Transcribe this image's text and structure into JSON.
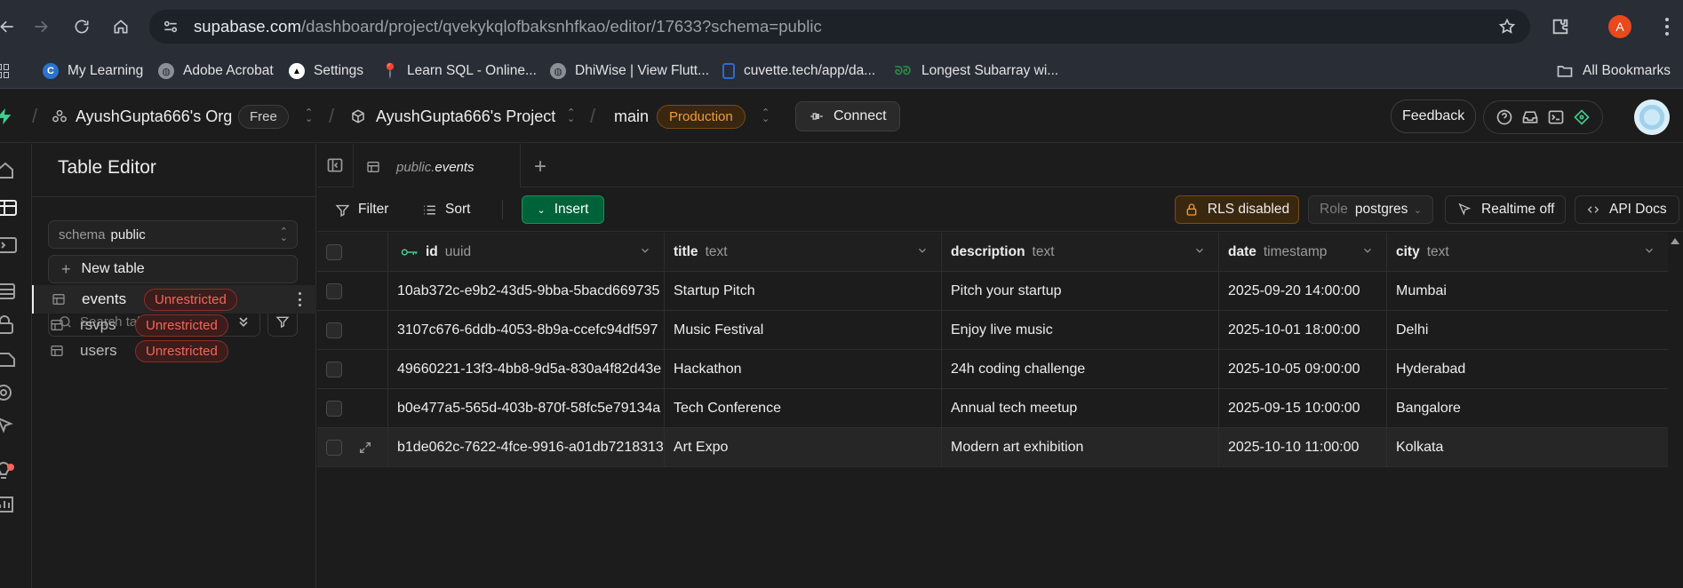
{
  "browser": {
    "url_host": "supabase.com",
    "url_path": "/dashboard/project/qvekykqlofbaksnhfkao/editor/17633?schema=public",
    "profile_initial": "A",
    "bookmarks": [
      {
        "label": "My Learning",
        "icon": "coursera-c-icon"
      },
      {
        "label": "Adobe Acrobat",
        "icon": "globe-icon"
      },
      {
        "label": "Settings",
        "icon": "triangle-logo-icon"
      },
      {
        "label": "Learn SQL - Online...",
        "icon": "pin-icon"
      },
      {
        "label": "DhiWise | View Flutt...",
        "icon": "globe-icon"
      },
      {
        "label": "cuvette.tech/app/da...",
        "icon": "cuvette-icon"
      },
      {
        "label": "Longest Subarray wi...",
        "icon": "gfg-icon"
      }
    ],
    "all_bookmarks": "All Bookmarks"
  },
  "topbar": {
    "org": "AyushGupta666's Org",
    "plan": "Free",
    "project": "AyushGupta666's Project",
    "branch": "main",
    "env": "Production",
    "connect": "Connect",
    "feedback": "Feedback"
  },
  "sidebar": {
    "title": "Table Editor",
    "schema_label": "schema",
    "schema_value": "public",
    "new_table": "New table",
    "search_placeholder": "Search tables...",
    "tables": [
      {
        "name": "events",
        "badge": "Unrestricted",
        "active": true
      },
      {
        "name": "rsvps",
        "badge": "Unrestricted",
        "active": false
      },
      {
        "name": "users",
        "badge": "Unrestricted",
        "active": false
      }
    ]
  },
  "tab": {
    "schema": "public.",
    "table": "events"
  },
  "toolbar": {
    "filter": "Filter",
    "sort": "Sort",
    "insert": "Insert",
    "rls": "RLS disabled",
    "role_label": "Role",
    "role_value": "postgres",
    "realtime": "Realtime off",
    "api_docs": "API Docs"
  },
  "grid": {
    "columns": [
      {
        "name": "id",
        "type": "uuid"
      },
      {
        "name": "title",
        "type": "text"
      },
      {
        "name": "description",
        "type": "text"
      },
      {
        "name": "date",
        "type": "timestamp"
      },
      {
        "name": "city",
        "type": "text"
      }
    ],
    "rows": [
      [
        "10ab372c-e9b2-43d5-9bba-5bacd669735",
        "Startup Pitch",
        "Pitch your startup",
        "2025-09-20 14:00:00",
        "Mumbai"
      ],
      [
        "3107c676-6ddb-4053-8b9a-ccefc94df597",
        "Music Festival",
        "Enjoy live music",
        "2025-10-01 18:00:00",
        "Delhi"
      ],
      [
        "49660221-13f3-4bb8-9d5a-830a4f82d43e",
        "Hackathon",
        "24h coding challenge",
        "2025-10-05 09:00:00",
        "Hyderabad"
      ],
      [
        "b0e477a5-565d-403b-870f-58fc5e79134a",
        "Tech Conference",
        "Annual tech meetup",
        "2025-09-15 10:00:00",
        "Bangalore"
      ],
      [
        "b1de062c-7622-4fce-9916-a01db7218313",
        "Art Expo",
        "Modern art exhibition",
        "2025-10-10 11:00:00",
        "Kolkata"
      ]
    ]
  },
  "colors": {
    "accent_green": "#3ecf8e",
    "insert_bg": "#006239",
    "warning": "#f39c2c",
    "danger": "#f2665c"
  }
}
